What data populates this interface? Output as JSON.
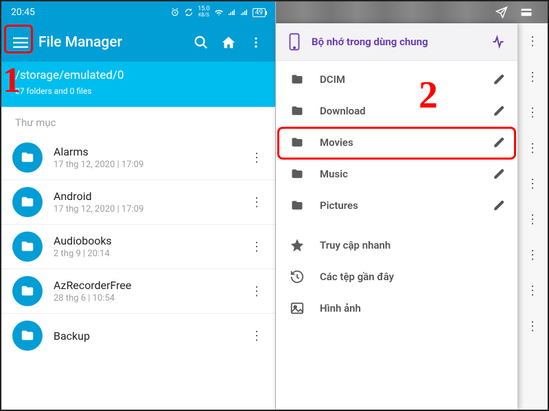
{
  "status": {
    "time": "20:45",
    "data_rate": "15.0",
    "data_unit": "KB/S",
    "battery": "49"
  },
  "toolbar": {
    "title": "File Manager"
  },
  "path_header": {
    "path": "/storage/emulated/0",
    "stats": "27 folders and 0 files"
  },
  "section_label": "Thư mục",
  "files": [
    {
      "name": "Alarms",
      "sub": "17 thg 12, 2020 | 17:09"
    },
    {
      "name": "Android",
      "sub": "17 thg 12, 2020 | 17:09"
    },
    {
      "name": "Audiobooks",
      "sub": "2 thg 9 | 20:14"
    },
    {
      "name": "AzRecorderFree",
      "sub": "28 thg 6 | 10:54"
    },
    {
      "name": "Backup",
      "sub": ""
    }
  ],
  "drawer": {
    "storage_label": "Bộ nhớ trong dùng chung",
    "folders": [
      {
        "label": "DCIM"
      },
      {
        "label": "Download"
      },
      {
        "label": "Movies"
      },
      {
        "label": "Music"
      },
      {
        "label": "Pictures"
      }
    ],
    "shortcuts": [
      {
        "label": "Truy cập nhanh",
        "icon": "star"
      },
      {
        "label": "Các tệp gần đây",
        "icon": "recent"
      },
      {
        "label": "Hình ảnh",
        "icon": "image"
      }
    ]
  },
  "annotations": {
    "num1": "1",
    "num2": "2"
  }
}
